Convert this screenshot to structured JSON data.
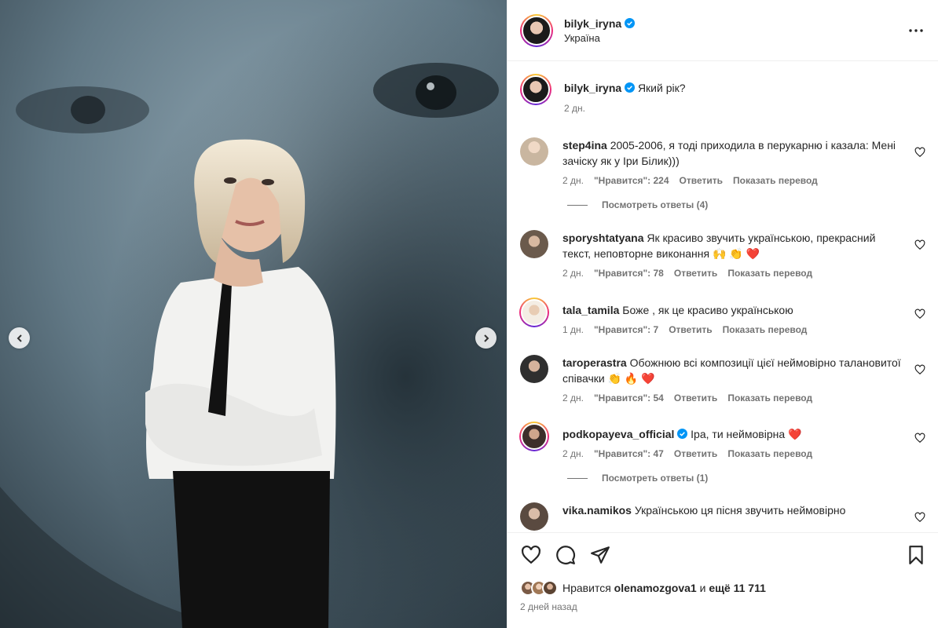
{
  "post": {
    "author": "bilyk_iryna",
    "location": "Україна"
  },
  "caption": {
    "author": "bilyk_iryna",
    "text": "Який рік?",
    "time": "2 дн."
  },
  "comments": [
    {
      "user": "step4ina",
      "text": "2005-2006, я тоді приходила в перукарню і казала: Мені зачіску як у Іри Білик)))",
      "time": "2 дн.",
      "likes": "\"Нравится\": 224",
      "reply": "Ответить",
      "translate": "Показать перевод",
      "replies": "Посмотреть ответы (4)",
      "avatar_color": "#c9b6a0"
    },
    {
      "user": "sporyshtatyana",
      "text": "Як красиво звучить українською, прекрасний текст, неповторне виконання 🙌 👏 ❤️",
      "time": "2 дн.",
      "likes": "\"Нравится\": 78",
      "reply": "Ответить",
      "translate": "Показать перевод",
      "avatar_color": "#6b5a4c"
    },
    {
      "user": "tala_tamila",
      "text": "Боже , як це красиво українською",
      "time": "1 дн.",
      "likes": "\"Нравится\": 7",
      "reply": "Ответить",
      "translate": "Показать перевод",
      "avatar_color": "#e6d8c8"
    },
    {
      "user": "taroperastra",
      "text": "Обожнюю всі композиції цієї неймовірно талановитої співачки 👏 🔥 ❤️",
      "time": "2 дн.",
      "likes": "\"Нравится\": 54",
      "reply": "Ответить",
      "translate": "Показать перевод",
      "avatar_color": "#2f2f2f"
    },
    {
      "user": "podkopayeva_official",
      "text": "Іра, ти неймовірна ❤️",
      "time": "2 дн.",
      "likes": "\"Нравится\": 47",
      "reply": "Ответить",
      "translate": "Показать перевод",
      "replies": "Посмотреть ответы (1)",
      "avatar_color": "#3d2e2a"
    },
    {
      "user": "vika.namikos",
      "text": "Українською ця пісня звучить неймовірно",
      "avatar_color": "#5a4a40"
    }
  ],
  "likes": {
    "prefix": "Нравится",
    "user": "olenamozgova1",
    "middle": "и",
    "rest": "ещё 11 711"
  },
  "date": "2 дней назад",
  "colors": {
    "verified": "#0095f6",
    "heart": "#ff3040",
    "muted": "#737373"
  }
}
